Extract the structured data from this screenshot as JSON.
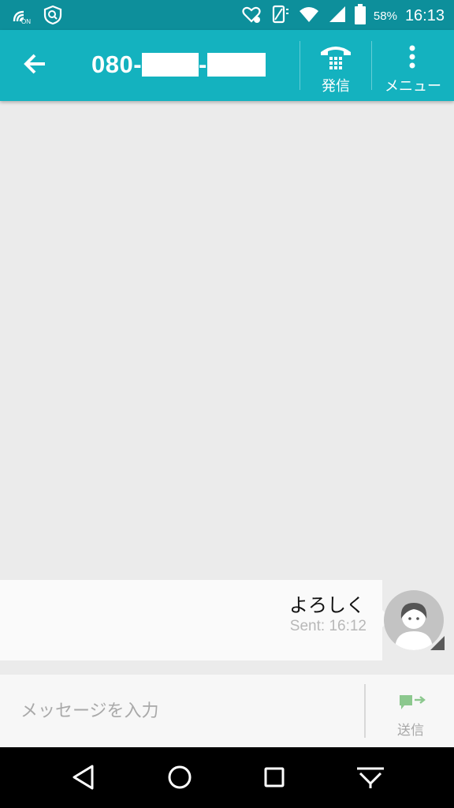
{
  "status_bar": {
    "time": "16:13",
    "battery_percent": "58%",
    "nfc_badge": "ON",
    "icons": [
      "nfc-icon",
      "shield-icon",
      "heart-health-icon",
      "vibrate-icon",
      "wifi-icon",
      "signal-icon",
      "battery-icon"
    ]
  },
  "header": {
    "number_prefix": "080-",
    "separator": "-",
    "call_label": "発信",
    "menu_label": "メニュー"
  },
  "messages": [
    {
      "text": "よろしく",
      "status": "Sent: 16:12"
    }
  ],
  "composer": {
    "placeholder": "メッセージを入力",
    "send_label": "送信"
  },
  "colors": {
    "status_bar": "#0d8f9b",
    "app_bar": "#14b2bf",
    "background": "#ebebeb",
    "send_icon": "#8cc88e"
  }
}
